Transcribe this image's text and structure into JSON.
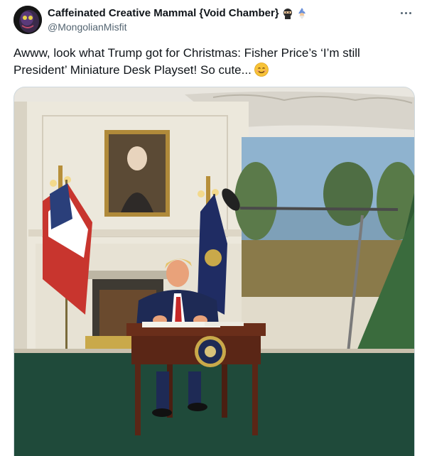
{
  "tweet": {
    "display_name": "Caffeinated Creative Mammal {Void Chamber}",
    "name_emojis": [
      "ninja-emoji",
      "wizard-emoji"
    ],
    "handle": "@MongolianMisfit",
    "text": "Awww, look what Trump got for Christmas: Fisher Price’s ‘I’m still President’ Miniature Desk Playset! So cute...",
    "text_emoji": "smiling-face-emoji",
    "more_icon": "more-options-icon"
  },
  "colors": {
    "text_primary": "#0f1419",
    "text_secondary": "#536471",
    "border": "#cfd9de",
    "background": "#ffffff"
  }
}
